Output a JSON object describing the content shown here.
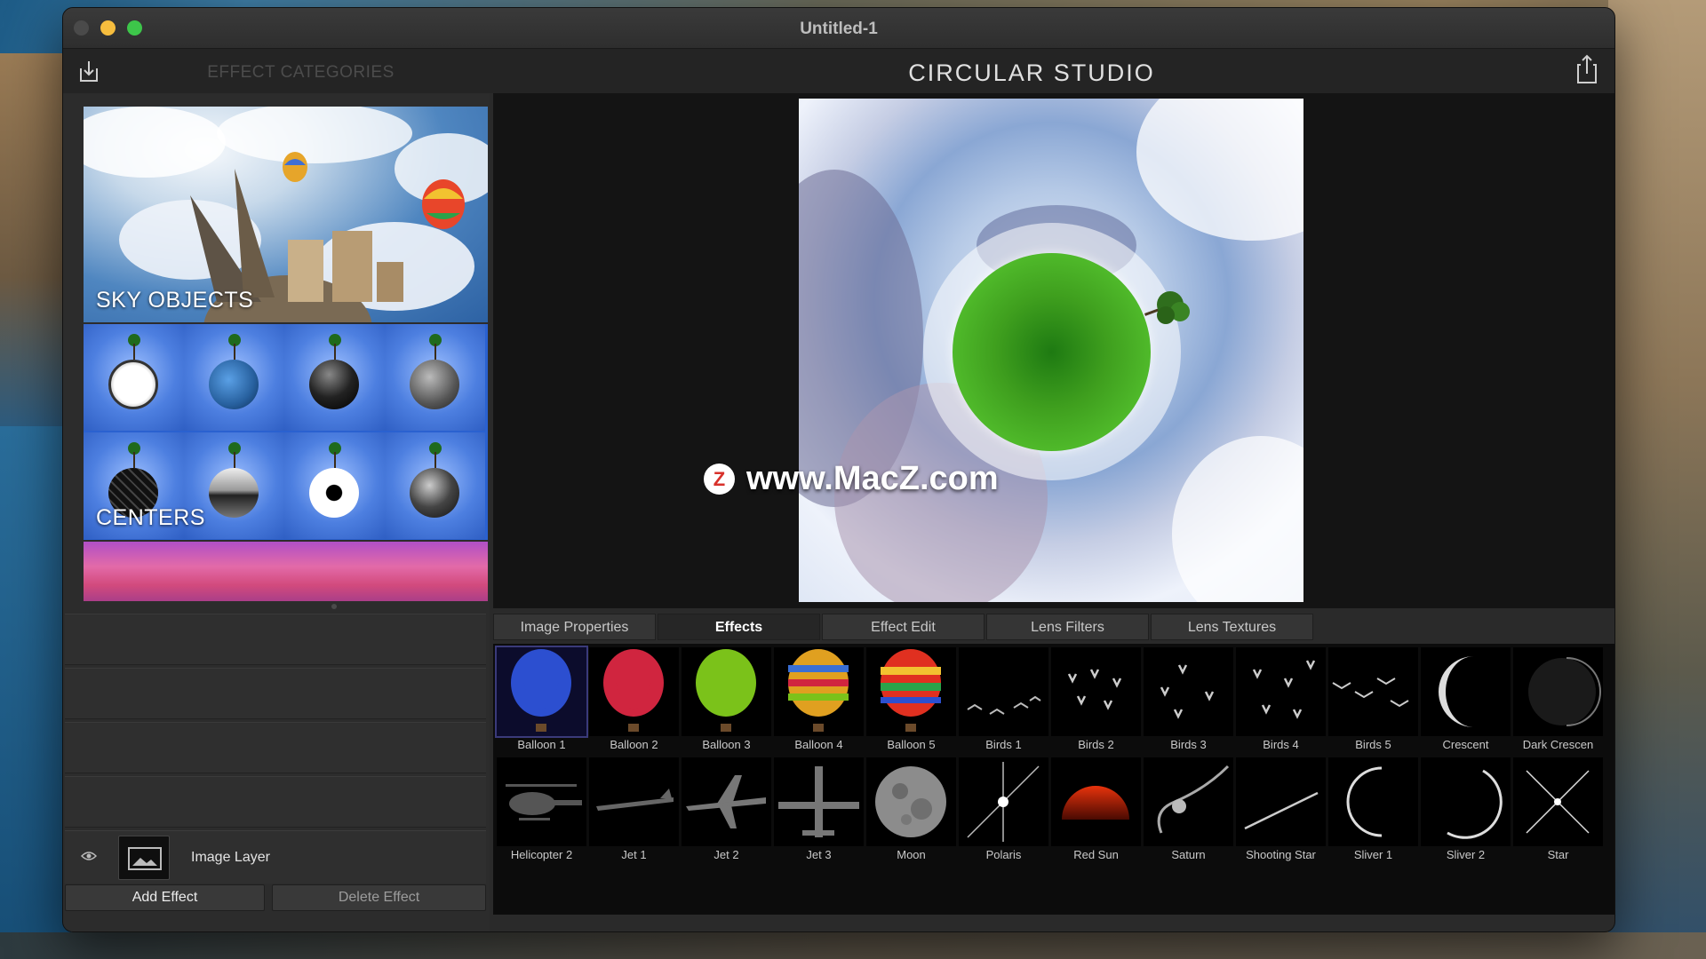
{
  "window": {
    "title": "Untitled-1"
  },
  "toolbar": {
    "categories_title": "EFFECT CATEGORIES",
    "brand": "CIRCULAR STUDIO"
  },
  "categories": [
    {
      "label": "SKY OBJECTS"
    },
    {
      "label": "CENTERS"
    },
    {
      "label": ""
    }
  ],
  "layers": {
    "name": "Image Layer"
  },
  "buttons": {
    "add_effect": "Add Effect",
    "delete_effect": "Delete Effect"
  },
  "watermark": {
    "icon_letter": "Z",
    "text": "www.MacZ.com"
  },
  "tabs": [
    {
      "label": "Image Properties"
    },
    {
      "label": "Effects"
    },
    {
      "label": "Effect Edit"
    },
    {
      "label": "Lens Filters"
    },
    {
      "label": "Lens Textures"
    }
  ],
  "active_tab": "Effects",
  "effects_row1": [
    {
      "label": "Balloon 1",
      "icon": "balloon-icon",
      "color": "#2c4fd0"
    },
    {
      "label": "Balloon 2",
      "icon": "balloon-icon",
      "color": "#d0253f"
    },
    {
      "label": "Balloon 3",
      "icon": "balloon-icon",
      "color": "#7bc21a"
    },
    {
      "label": "Balloon 4",
      "icon": "balloon-icon",
      "color": "#e0a020"
    },
    {
      "label": "Balloon 5",
      "icon": "balloon-icon",
      "color": "#e03020"
    },
    {
      "label": "Birds 1",
      "icon": "birds-icon"
    },
    {
      "label": "Birds 2",
      "icon": "birds-icon"
    },
    {
      "label": "Birds 3",
      "icon": "birds-icon"
    },
    {
      "label": "Birds 4",
      "icon": "birds-icon"
    },
    {
      "label": "Birds 5",
      "icon": "birds-icon"
    },
    {
      "label": "Crescent",
      "icon": "crescent-icon"
    },
    {
      "label": "Dark Crescen",
      "icon": "dark-crescent-icon"
    }
  ],
  "effects_row2": [
    {
      "label": "Helicopter 2",
      "icon": "helicopter-icon"
    },
    {
      "label": "Jet 1",
      "icon": "jet-icon"
    },
    {
      "label": "Jet 2",
      "icon": "jet-icon"
    },
    {
      "label": "Jet 3",
      "icon": "jet-icon"
    },
    {
      "label": "Moon",
      "icon": "moon-icon"
    },
    {
      "label": "Polaris",
      "icon": "star-flare-icon"
    },
    {
      "label": "Red Sun",
      "icon": "red-sun-icon"
    },
    {
      "label": "Saturn",
      "icon": "saturn-icon"
    },
    {
      "label": "Shooting Star",
      "icon": "shooting-star-icon"
    },
    {
      "label": "Sliver 1",
      "icon": "sliver-icon"
    },
    {
      "label": "Sliver 2",
      "icon": "sliver-icon"
    },
    {
      "label": "Star",
      "icon": "star-icon"
    }
  ]
}
